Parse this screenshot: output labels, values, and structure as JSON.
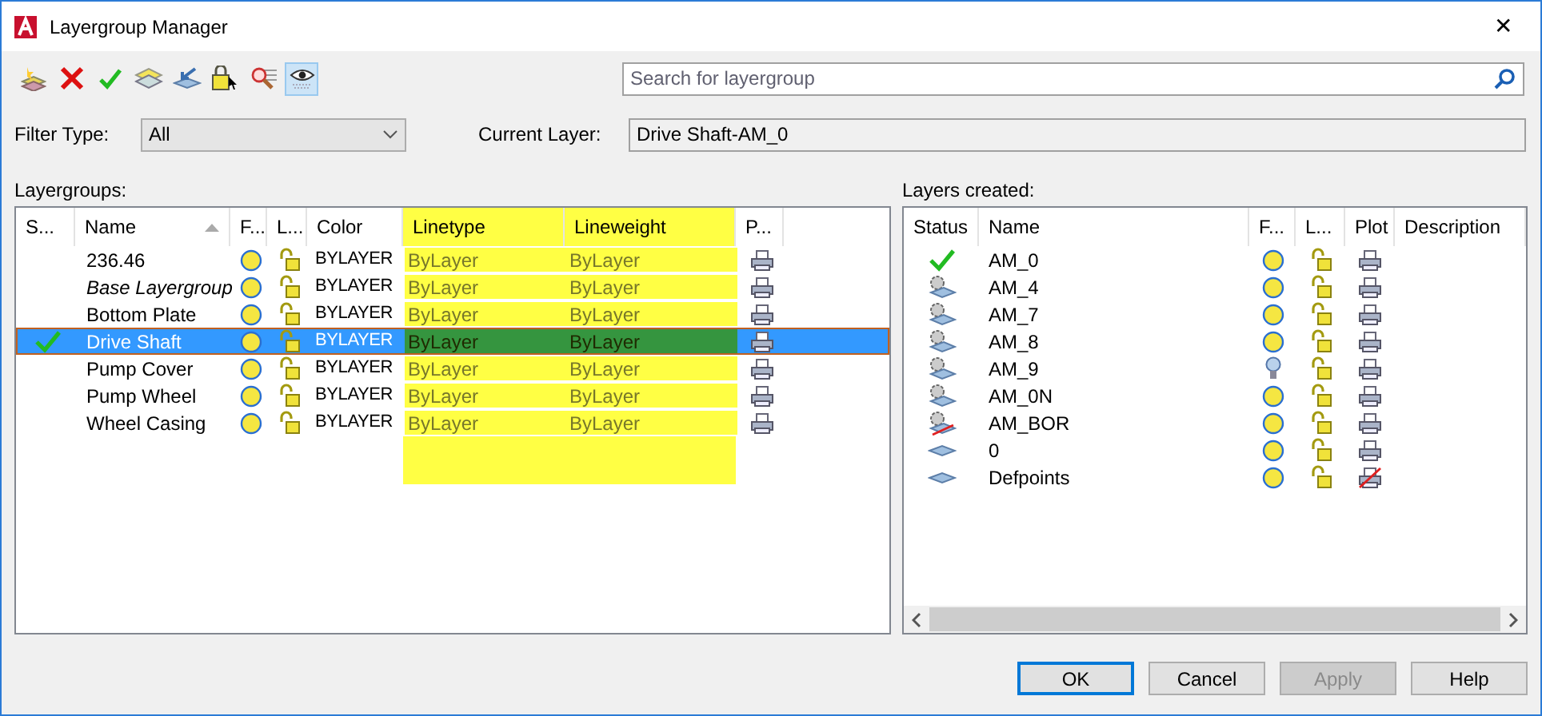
{
  "window": {
    "title": "Layergroup Manager",
    "close": "✕"
  },
  "toolbar": [
    {
      "kind": "new",
      "selected": false
    },
    {
      "kind": "delete",
      "selected": false
    },
    {
      "kind": "check",
      "selected": false
    },
    {
      "kind": "layers",
      "selected": false
    },
    {
      "kind": "import",
      "selected": false
    },
    {
      "kind": "lock",
      "selected": false
    },
    {
      "kind": "find",
      "selected": false
    },
    {
      "kind": "eye",
      "selected": true
    }
  ],
  "search": {
    "placeholder": "Search for layergroup"
  },
  "filter": {
    "label": "Filter Type:",
    "value": "All"
  },
  "current_layer": {
    "label": "Current Layer:",
    "value": "Drive Shaft-AM_0"
  },
  "layergroups": {
    "label": "Layergroups:",
    "sort_ascending": true,
    "columns": [
      {
        "label": "S...",
        "highlighted": false
      },
      {
        "label": "Name",
        "highlighted": false
      },
      {
        "label": "F...",
        "highlighted": false
      },
      {
        "label": "L...",
        "highlighted": false
      },
      {
        "label": "Color",
        "highlighted": false
      },
      {
        "label": "Linetype",
        "highlighted": true
      },
      {
        "label": "Lineweight",
        "highlighted": true
      },
      {
        "label": "P...",
        "highlighted": false
      }
    ],
    "rows": [
      {
        "name": "236.46",
        "italic": false,
        "current": false,
        "selected": false,
        "color_name": "BYLAYER",
        "linetype": "ByLayer",
        "lineweight": "ByLayer"
      },
      {
        "name": "Base Layergroup",
        "italic": true,
        "current": false,
        "selected": false,
        "color_name": "BYLAYER",
        "linetype": "ByLayer",
        "lineweight": "ByLayer"
      },
      {
        "name": "Bottom Plate",
        "italic": false,
        "current": false,
        "selected": false,
        "color_name": "BYLAYER",
        "linetype": "ByLayer",
        "lineweight": "ByLayer"
      },
      {
        "name": "Drive Shaft",
        "italic": false,
        "current": true,
        "selected": true,
        "color_name": "BYLAYER",
        "linetype": "ByLayer",
        "lineweight": "ByLayer"
      },
      {
        "name": "Pump Cover",
        "italic": false,
        "current": false,
        "selected": false,
        "color_name": "BYLAYER",
        "linetype": "ByLayer",
        "lineweight": "ByLayer"
      },
      {
        "name": "Pump Wheel",
        "italic": false,
        "current": false,
        "selected": false,
        "color_name": "BYLAYER",
        "linetype": "ByLayer",
        "lineweight": "ByLayer"
      },
      {
        "name": "Wheel Casing",
        "italic": false,
        "current": false,
        "selected": false,
        "color_name": "BYLAYER",
        "linetype": "ByLayer",
        "lineweight": "ByLayer"
      }
    ]
  },
  "layers": {
    "label": "Layers created:",
    "columns": [
      "Status",
      "Name",
      "F...",
      "L...",
      "Plot",
      "Description"
    ],
    "rows": [
      {
        "kind": "current",
        "name": "AM_0",
        "freeze": {
          "kind": "sun"
        },
        "plot": true
      },
      {
        "kind": "gear",
        "name": "AM_4",
        "freeze": {
          "kind": "sun"
        },
        "plot": true
      },
      {
        "kind": "gear",
        "name": "AM_7",
        "freeze": {
          "kind": "sun"
        },
        "plot": true
      },
      {
        "kind": "gear",
        "name": "AM_8",
        "freeze": {
          "kind": "sun"
        },
        "plot": true
      },
      {
        "kind": "gear",
        "name": "AM_9",
        "freeze": {
          "kind": "bulb"
        },
        "plot": true
      },
      {
        "kind": "gear",
        "name": "AM_0N",
        "freeze": {
          "kind": "sun"
        },
        "plot": true
      },
      {
        "kind": "unused",
        "name": "AM_BOR",
        "freeze": {
          "kind": "sun"
        },
        "plot": true
      },
      {
        "kind": "plain",
        "name": "0",
        "freeze": {
          "kind": "sun"
        },
        "plot": true
      },
      {
        "kind": "plain",
        "name": "Defpoints",
        "freeze": {
          "kind": "sun"
        },
        "plot": false
      }
    ]
  },
  "buttons": [
    {
      "label": "OK",
      "default": true,
      "disabled": false
    },
    {
      "label": "Cancel",
      "default": false,
      "disabled": false
    },
    {
      "label": "Apply",
      "default": false,
      "disabled": true
    },
    {
      "label": "Help",
      "default": false,
      "disabled": false
    }
  ]
}
